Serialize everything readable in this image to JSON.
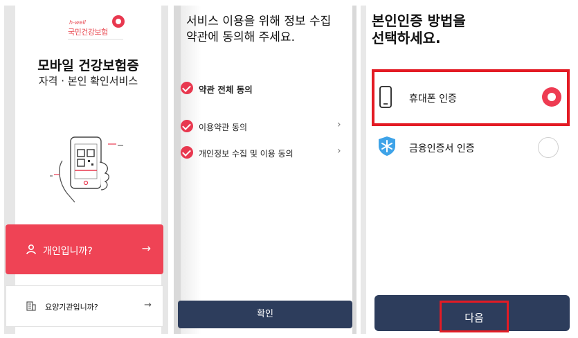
{
  "panel1": {
    "logo_en": "h-well",
    "logo_ko": "국민건강보험",
    "title": "모바일 건강보험증",
    "subtitle": "자격 · 본인 확인서비스",
    "personal_button": "개인입니까?",
    "facility_button": "요양기관입니까?",
    "arrow": "→"
  },
  "panel2": {
    "title_line1": "서비스 이용을 위해 정보 수집",
    "title_line2": "약관에 동의해 주세요.",
    "agree_all": "약관 전체 동의",
    "terms": [
      "이용약관 동의",
      "개인정보 수집 및 이용 동의"
    ],
    "chevron": "›",
    "confirm": "확인"
  },
  "panel3": {
    "title_line1": "본인인증 방법을",
    "title_line2": "선택하세요.",
    "option_phone": "휴대폰 인증",
    "option_cert": "금융인증서 인증",
    "next": "다음"
  },
  "colors": {
    "brand_red": "#ef4355",
    "navy": "#2d3d5c",
    "highlight": "#e31b24",
    "cert_blue": "#3ea3e8"
  },
  "icons": [
    "person-icon",
    "arrow-right-icon",
    "building-icon",
    "check-icon",
    "chevron-right-icon",
    "phone-icon",
    "certificate-icon"
  ]
}
